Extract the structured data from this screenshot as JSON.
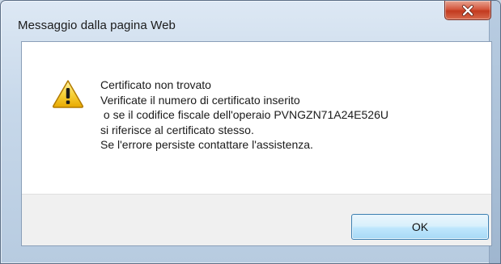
{
  "window": {
    "title": "Messaggio dalla pagina Web"
  },
  "dialog": {
    "icon": "warning-icon",
    "message_lines": [
      "Certificato non trovato",
      "Verificate il numero di certificato inserito",
      " o se il codifice fiscale dell'operaio PVNGZN71A24E526U",
      "si riferisce al certificato stesso.",
      "Se l'errore persiste contattare l'assistenza."
    ],
    "ok_label": "OK"
  },
  "colors": {
    "close_button": "#c23a1f",
    "warning_yellow": "#f5c400",
    "ok_border": "#3c7fb1"
  }
}
